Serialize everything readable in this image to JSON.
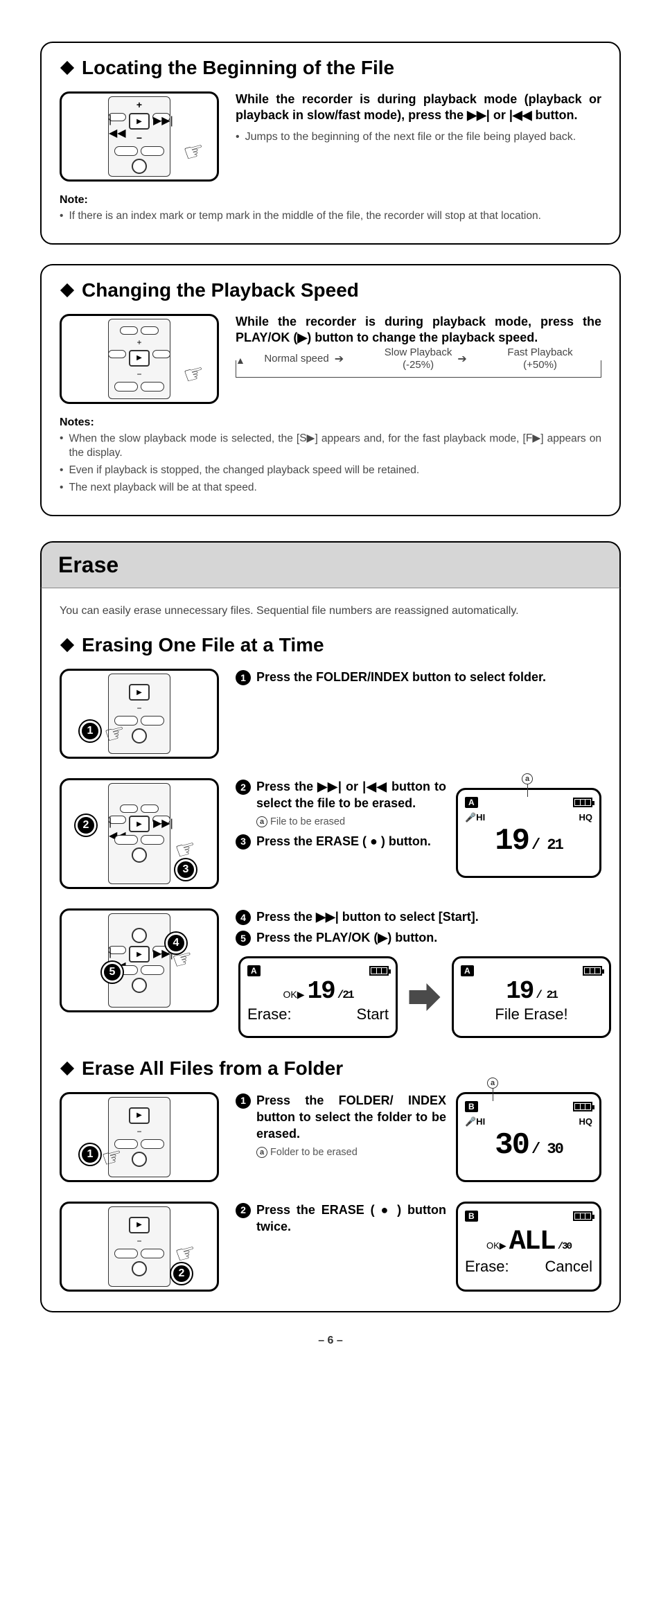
{
  "section1": {
    "heading": "Locating the Beginning of the File",
    "bold_text": "While the recorder is during playback mode (playback or playback in slow/fast mode), press the ▶▶| or |◀◀ button.",
    "bullet1": "Jumps to the beginning of the next file or the file being played back.",
    "note_label": "Note:",
    "note1": "If there is an index mark or temp mark in the middle of the file, the recorder will stop at that location."
  },
  "section2": {
    "heading": "Changing the Playback Speed",
    "bold_text": "While the recorder is during playback mode, press the PLAY/OK (▶) button to change the playback speed.",
    "speed1": "Normal speed",
    "speed2_a": "Slow Playback",
    "speed2_b": "(-25%)",
    "speed3_a": "Fast Playback",
    "speed3_b": "(+50%)",
    "notes_label": "Notes:",
    "n1_a": "When the slow playback mode is selected, the [",
    "n1_b": "] appears and, for the fast playback mode, [",
    "n1_c": "] appears on the display.",
    "n2": "Even if playback is stopped, the changed playback speed will be retained.",
    "n3": "The next playback will be at that speed."
  },
  "erase": {
    "title": "Erase",
    "intro": "You can easily erase unnecessary files. Sequential file numbers are reassigned automatically.",
    "sub1": "Erasing One File at a Time",
    "step1": "Press the FOLDER/INDEX button to select folder.",
    "step2": "Press the ▶▶| or |◀◀ button to select the file to be erased.",
    "step2_note": "File to be erased",
    "step3": "Press the ERASE ( ● ) button.",
    "step4": "Press the ▶▶| button to select [Start].",
    "step5": "Press the PLAY/OK (▶) button.",
    "lcd1_folder": "A",
    "lcd1_hq": "HQ",
    "lcd1_file": "19",
    "lcd1_total": "/ 21",
    "lcd1_mic": "🎤HI",
    "lcd_erase": "Erase:",
    "lcd_start": "Start",
    "lcd_fileerase": "File Erase!",
    "sub2": "Erase All Files from a Folder",
    "f_step1": "Press the FOLDER/ INDEX button to select the folder to be erased.",
    "f_step1_note": "Folder to be erased",
    "f_step2": "Press the ERASE ( ● ) button twice.",
    "lcd2_folder": "B",
    "lcd2_file": "30",
    "lcd2_total": "/ 30",
    "lcd3_all": "ALL",
    "lcd_cancel": "Cancel"
  },
  "page": "– 6 –",
  "icons": {
    "slow": "S▶",
    "fast": "F▶"
  }
}
